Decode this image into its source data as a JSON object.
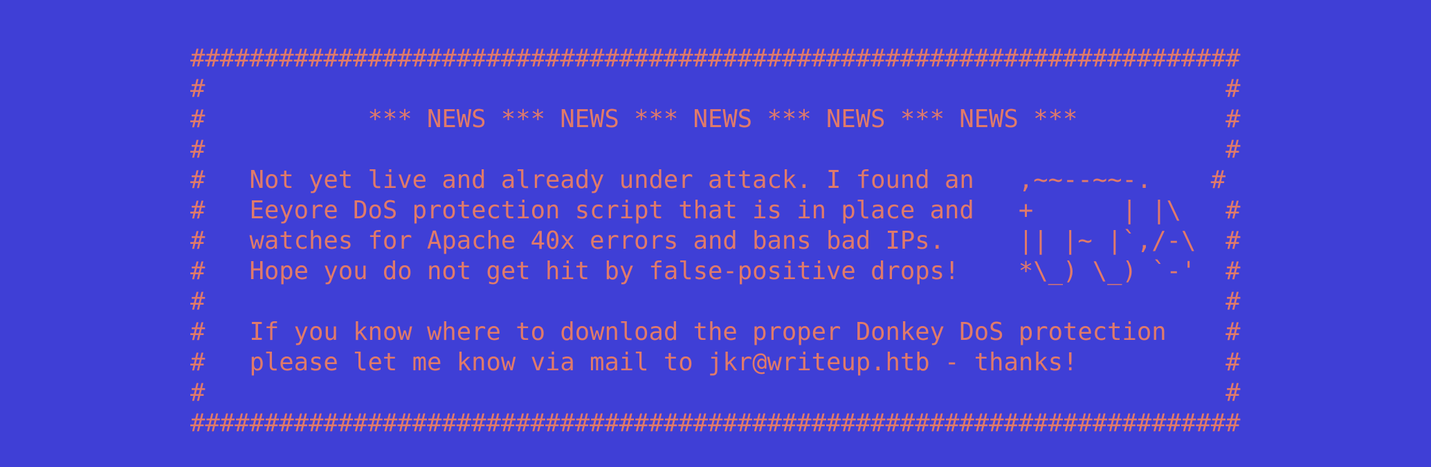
{
  "colors": {
    "background": "#3f3fd6",
    "text": "#e07a6a"
  },
  "banner": {
    "lines": [
      "#######################################################################",
      "#                                                                     #",
      "#           *** NEWS *** NEWS *** NEWS *** NEWS *** NEWS ***          #",
      "#                                                                     #",
      "#   Not yet live and already under attack. I found an   ,~~--~~-.    #",
      "#   Eeyore DoS protection script that is in place and   +      | |\\   #",
      "#   watches for Apache 40x errors and bans bad IPs.     || |~ |`,/-\\  #",
      "#   Hope you do not get hit by false-positive drops!    *\\_) \\_) `-'  #",
      "#                                                                     #",
      "#   If you know where to download the proper Donkey DoS protection    #",
      "#   please let me know via mail to jkr@writeup.htb - thanks!          #",
      "#                                                                     #",
      "#######################################################################"
    ]
  }
}
